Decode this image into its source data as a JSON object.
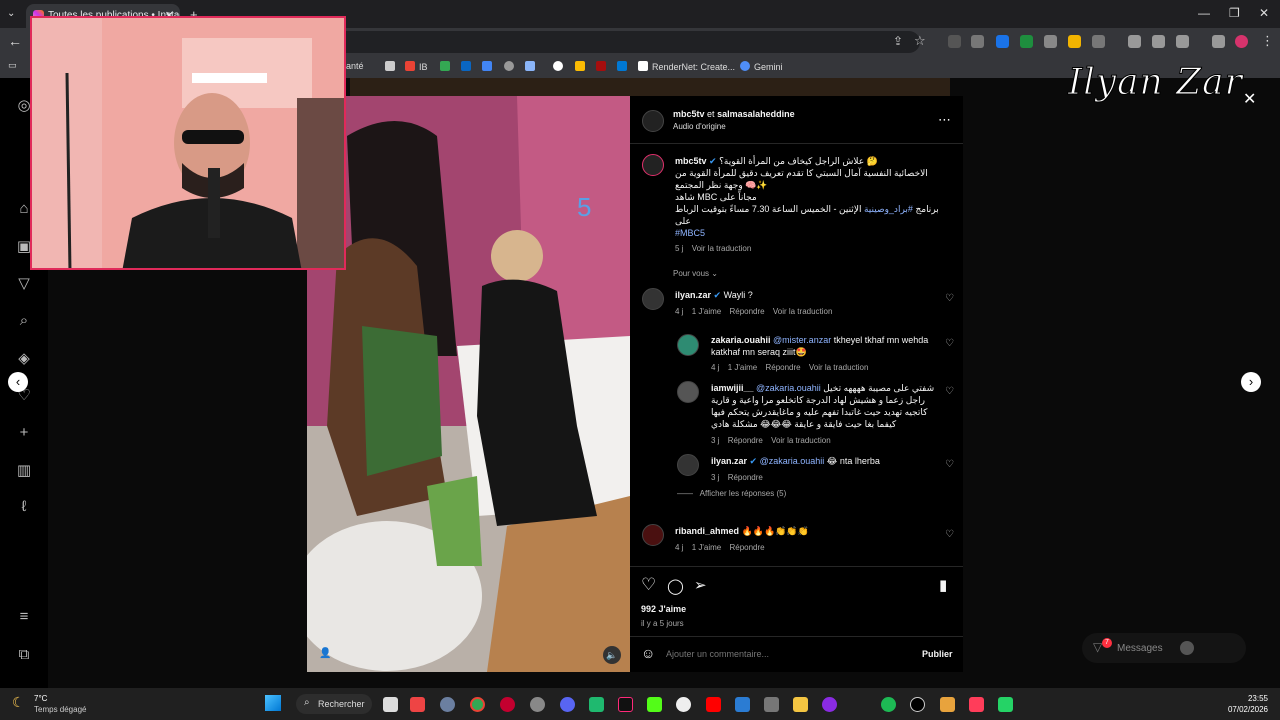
{
  "browser": {
    "tab_title": "Toutes les publications • Instag",
    "bookmarks": [
      "Santé",
      "IB",
      "RenderNet: Create...",
      "Gemini"
    ]
  },
  "streamer": {
    "name": "Ilyan Zar"
  },
  "post": {
    "header_accounts": "mbc5tv et salmasalaheddine",
    "header_account_1": "mbc5tv",
    "header_et": "et",
    "header_account_2": "salmasalaheddine",
    "audio": "Audio d'origine",
    "caption": {
      "user": "mbc5tv",
      "line1": "علاش الراجل كيخاف من المرأة القوية؟ 🤔",
      "line2": "الاخصائية النفسية آمال السبتي كا تقدم تعريف دقيق للمرأة القوية من",
      "line3": "وجهة نظر المجتمع 🧠✨",
      "line4": "شاهد MBC مجاناً على",
      "line5_prefix": "برنامج",
      "line5_tag": "#براد_وصينية",
      "line5_suffix": "الإثنين - الخميس الساعة 7.30 مساءً بتوقيت الرباط",
      "line6": "على",
      "hashtag": "#MBC5",
      "time": "5 j",
      "translate": "Voir la traduction"
    },
    "for_you": "Pour vous",
    "comments": [
      {
        "user": "ilyan.zar",
        "text": "Wayli ?",
        "time": "4 j",
        "likes": "1 J'aime",
        "reply": "Répondre",
        "translate": "Voir la traduction"
      },
      {
        "user": "zakaria.ouahii",
        "mention": "@mister.anzar",
        "text": "tkheyel tkhaf mn wehda katkhaf mn seraq ziiit🤩",
        "time": "4 j",
        "likes": "1 J'aime",
        "reply": "Répondre",
        "translate": "Voir la traduction"
      },
      {
        "user": "iamwijii__",
        "mention": "@zakaria.ouahii",
        "text_1": "شفتي على مصيبة ههههه تخيل",
        "text_2": "راجل زعما و هشيش لهاد الدرجة كاتخلعو مرا واعية و قارية",
        "text_3": "كاتجيه تهديد حيت غاتبدا تفهم عليه و ماغايقدرش يتحكم فيها",
        "text_4": "كيفما بغا حيت فايقة و عايقة 😂😂😂 مشكلة هادي",
        "time": "3 j",
        "reply": "Répondre",
        "translate": "Voir la traduction"
      },
      {
        "user": "ilyan.zar",
        "mention": "@zakaria.ouahii",
        "text": "😂 nta lherba",
        "time": "3 j",
        "reply": "Répondre"
      },
      {
        "user": "ribandi_ahmed",
        "text": "🔥🔥🔥👏👏👏",
        "time": "4 j",
        "likes": "1 J'aime",
        "reply": "Répondre"
      }
    ],
    "view_replies": "Afficher les réponses (5)",
    "likes": "992 J'aime",
    "posted": "il y a 5 jours",
    "comment_placeholder": "Ajouter un commentaire...",
    "publish": "Publier"
  },
  "messages": {
    "label": "Messages",
    "badge": "7"
  },
  "taskbar": {
    "weather_temp": "7°C",
    "weather_desc": "Temps dégagé",
    "search": "Rechercher",
    "time": "23:55",
    "date": "07/02/2026"
  }
}
